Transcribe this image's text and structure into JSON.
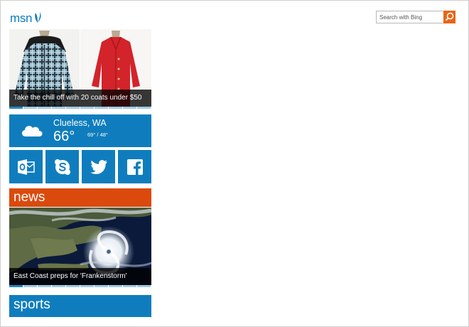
{
  "header": {
    "logo": "msn",
    "search_placeholder": "Search with Bing",
    "search_icon": "search-icon",
    "accent_color": "#e86517"
  },
  "hero": {
    "caption": "Take the chill off with 20 coats under $50"
  },
  "weather": {
    "city": "Clueless, WA",
    "temp": "66°",
    "range": "69° / 48°",
    "icon": "cloud-icon"
  },
  "social": {
    "tiles": [
      {
        "name": "outlook",
        "icon": "outlook-icon"
      },
      {
        "name": "skype",
        "icon": "skype-icon"
      },
      {
        "name": "twitter",
        "icon": "twitter-icon"
      },
      {
        "name": "facebook",
        "icon": "facebook-icon"
      }
    ],
    "tile_color": "#0f7dbd"
  },
  "news": {
    "heading": "news",
    "caption": "East Coast preps for 'Frankenstorm'",
    "heading_color": "#db4a0c"
  },
  "sports": {
    "heading": "sports"
  }
}
